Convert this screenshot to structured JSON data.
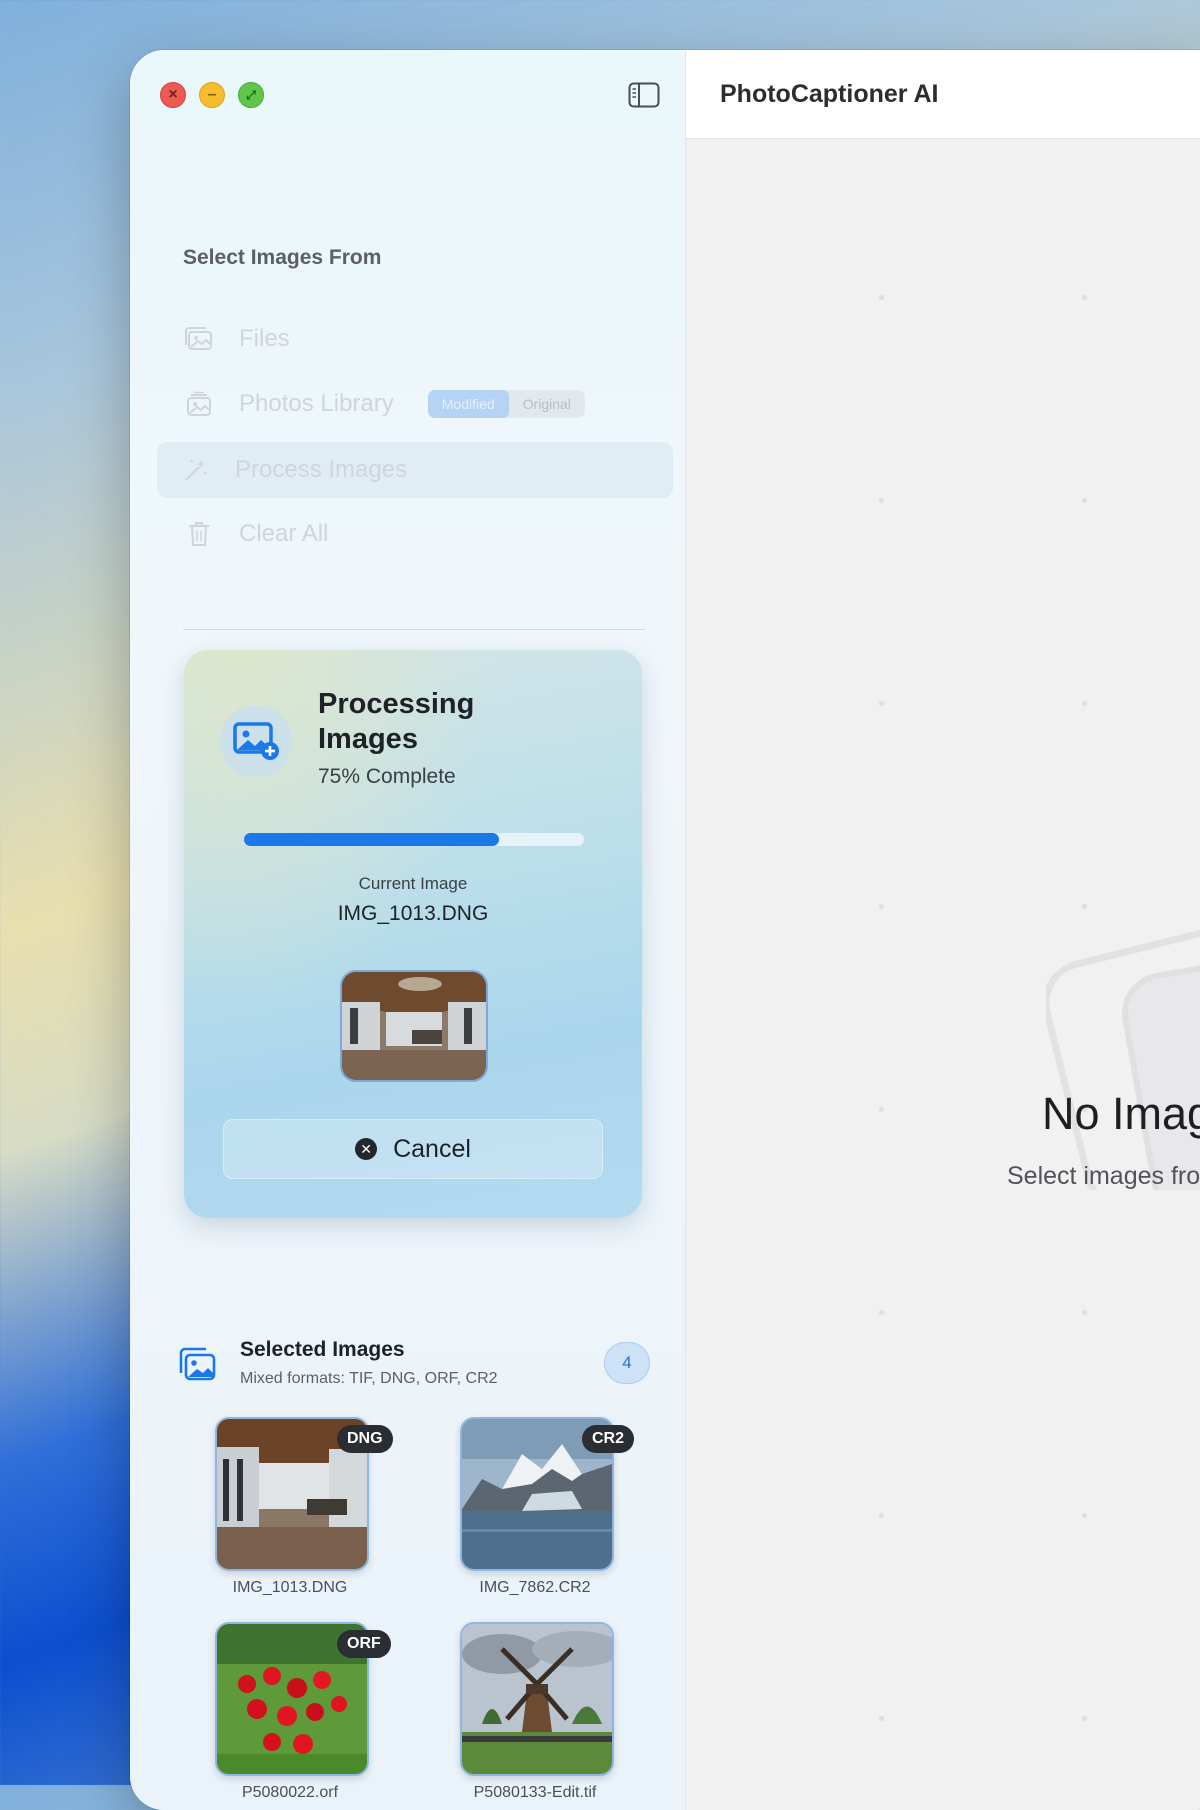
{
  "window": {
    "app_title": "PhotoCaptioner AI"
  },
  "sidebar": {
    "section_title": "Select Images From",
    "menu": {
      "files": "Files",
      "photos_library": "Photos Library",
      "photos_segment": [
        "Modified",
        "Original"
      ],
      "process_images": "Process Images",
      "clear_all": "Clear All"
    }
  },
  "processing": {
    "title": "Processing Images",
    "percent_text": "75% Complete",
    "progress_fraction": 0.75,
    "current_label": "Current Image",
    "current_name": "IMG_1013.DNG",
    "cancel_label": "Cancel"
  },
  "selected": {
    "title": "Selected Images",
    "subtitle": "Mixed formats: TIF, DNG, ORF, CR2",
    "count": "4",
    "images": [
      {
        "name": "IMG_1013.DNG",
        "badge": "DNG"
      },
      {
        "name": "IMG_7862.CR2",
        "badge": "CR2"
      },
      {
        "name": "P5080022.orf",
        "badge": "ORF"
      },
      {
        "name": "P5080133-Edit.tif",
        "badge": ""
      }
    ]
  },
  "empty_state": {
    "title": "No Images Pro",
    "subtitle": "Select images from the side"
  },
  "colors": {
    "accent": "#1b78e8",
    "close": "#ee5a52",
    "minimize": "#f6be2f",
    "zoom": "#5fc649"
  }
}
